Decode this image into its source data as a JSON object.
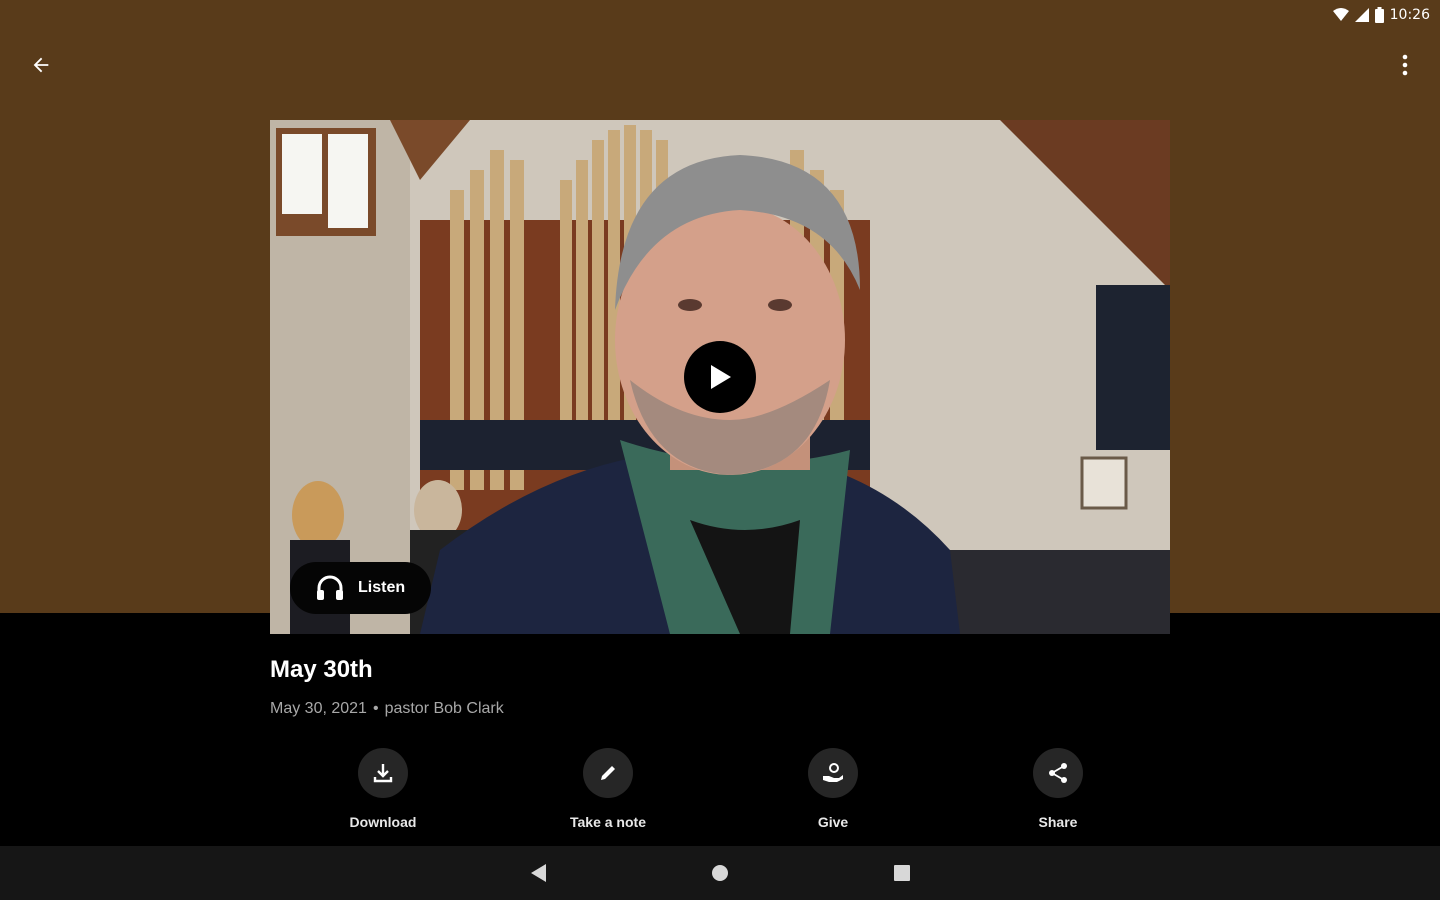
{
  "status_bar": {
    "time": "10:26"
  },
  "app_bar": {
    "back_icon": "arrow-back-icon",
    "more_icon": "more-vert-icon"
  },
  "media": {
    "play_icon": "play-icon",
    "listen_label": "Listen",
    "listen_icon": "headphones-icon"
  },
  "sermon": {
    "title": "May 30th",
    "date": "May 30, 2021",
    "separator": "•",
    "speaker": "pastor Bob Clark"
  },
  "actions": [
    {
      "label": "Download",
      "icon": "download-icon"
    },
    {
      "label": "Take a note",
      "icon": "pencil-icon"
    },
    {
      "label": "Give",
      "icon": "give-hand-icon"
    },
    {
      "label": "Share",
      "icon": "share-icon"
    }
  ],
  "colors": {
    "header_background": "#593b1a",
    "page_background": "#000000",
    "action_circle": "#262626",
    "nav_bar": "#161616"
  }
}
